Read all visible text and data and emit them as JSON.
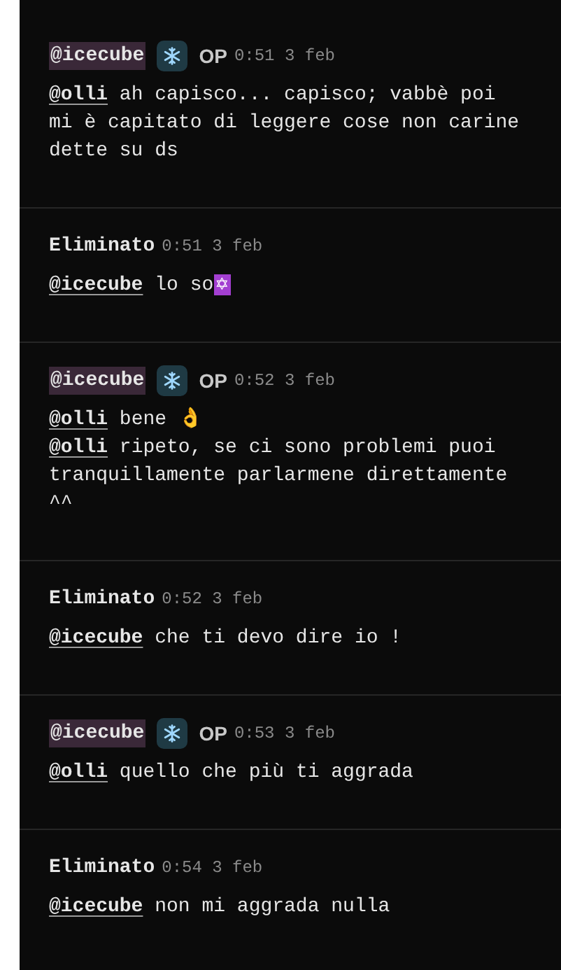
{
  "posts": [
    {
      "author": "@icecube",
      "highlighted": true,
      "badge": true,
      "op_label": "OP",
      "time": "0:51 3 feb",
      "lines": [
        {
          "mention": "@olli",
          "text": "ah capisco... capisco; vabbè poi mi è capitato di leggere cose non carine dette su ds"
        }
      ]
    },
    {
      "author": "Eliminato",
      "highlighted": false,
      "badge": false,
      "time": "0:51 3 feb",
      "lines": [
        {
          "mention": "@icecube",
          "text": "lo so",
          "emoji": "✡"
        }
      ]
    },
    {
      "author": "@icecube",
      "highlighted": true,
      "badge": true,
      "op_label": "OP",
      "time": "0:52 3 feb",
      "lines": [
        {
          "mention": "@olli",
          "text": "bene 👌"
        },
        {
          "mention": "@olli",
          "text": "ripeto, se ci sono problemi puoi tranquillamente parlarmene direttamente ^^"
        }
      ]
    },
    {
      "author": "Eliminato",
      "highlighted": false,
      "badge": false,
      "time": "0:52 3 feb",
      "lines": [
        {
          "mention": "@icecube",
          "text": "che ti devo dire io !"
        }
      ]
    },
    {
      "author": "@icecube",
      "highlighted": true,
      "badge": true,
      "op_label": "OP",
      "time": "0:53 3 feb",
      "lines": [
        {
          "mention": "@olli",
          "text": "quello che più ti aggrada"
        }
      ]
    },
    {
      "author": "Eliminato",
      "highlighted": false,
      "badge": false,
      "time": "0:54 3 feb",
      "lines": [
        {
          "mention": "@icecube",
          "text": "non mi aggrada nulla"
        }
      ]
    }
  ]
}
